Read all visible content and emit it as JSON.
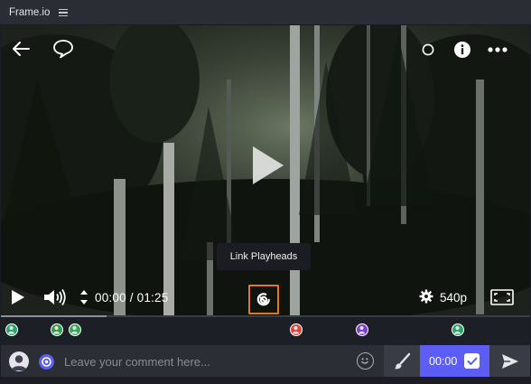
{
  "window": {
    "title": "Frame.io"
  },
  "player": {
    "tooltip": "Link Playheads",
    "timecode": "00:00 / 01:25",
    "quality": "540p",
    "progress": 0.2
  },
  "timeline": {
    "markers": [
      {
        "color": "#2fa36b",
        "icon": "avatar-marker"
      },
      {
        "color": "#3a9a4c",
        "icon": "avatar-marker"
      },
      {
        "color": "#3ba55c",
        "icon": "avatar-marker"
      },
      {
        "color": "#d44a3f",
        "icon": "avatar-marker"
      },
      {
        "color": "#7b3fd1",
        "icon": "avatar-marker"
      },
      {
        "color": "#2fa36b",
        "icon": "avatar-marker"
      }
    ]
  },
  "comment": {
    "placeholder": "Leave your comment here...",
    "timestamp": "00:00"
  },
  "colors": {
    "accent": "#5b5df5",
    "highlight": "#e07a1e"
  }
}
